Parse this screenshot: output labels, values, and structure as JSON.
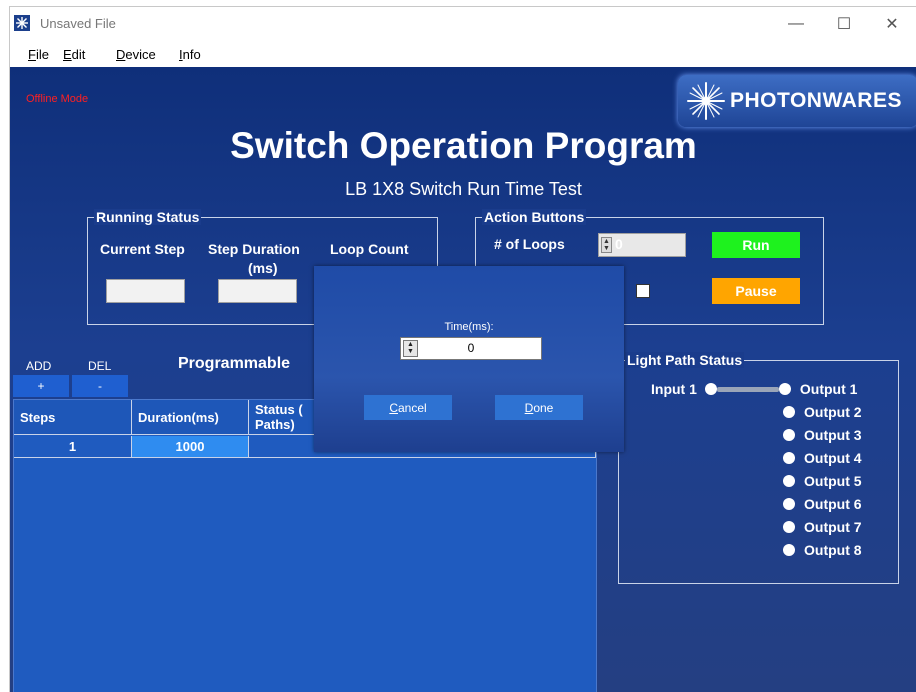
{
  "window": {
    "title": "Unsaved File",
    "controls": {
      "minimize": "—",
      "maximize": "☐",
      "close": "✕"
    }
  },
  "menu": {
    "items": [
      {
        "accel": "F",
        "rest": "ile"
      },
      {
        "accel": "E",
        "rest": "dit"
      },
      {
        "accel": "D",
        "rest": "evice"
      },
      {
        "accel": "I",
        "rest": "nfo"
      }
    ]
  },
  "header": {
    "offline_mode": "Offline Mode",
    "logo_text": "PHOTONWARES",
    "title": "Switch Operation Program",
    "subtitle": "LB 1X8 Switch Run Time Test"
  },
  "running_status": {
    "label": "Running Status",
    "current_step": "Current Step",
    "step_duration_1": "Step Duration",
    "step_duration_2": "(ms)",
    "loop_count": "Loop Count"
  },
  "action_buttons": {
    "label": "Action Buttons",
    "loops_label": "# of Loops",
    "loops_value": "0",
    "run": "Run",
    "pause": "Pause"
  },
  "programmable": {
    "add_label": "ADD",
    "del_label": "DEL",
    "add_button": "+",
    "del_button": "-",
    "title": "Programmable",
    "columns": [
      "Steps",
      "Duration(ms)",
      "Status (\nPaths)"
    ],
    "rows": [
      {
        "step": "1",
        "duration": "1000"
      }
    ]
  },
  "light_path": {
    "label": "Light Path Status",
    "input": "Input 1",
    "outputs": [
      "Output 1",
      "Output 2",
      "Output 3",
      "Output 4",
      "Output 5",
      "Output 6",
      "Output 7",
      "Output 8"
    ]
  },
  "dialog": {
    "label": "Time(ms):",
    "value": "0",
    "cancel": {
      "accel": "C",
      "rest": "ancel"
    },
    "done": {
      "accel": "D",
      "rest": "one"
    }
  },
  "colors": {
    "run_green": "#1ef21e",
    "pause_orange": "#ffa500",
    "offline_red": "#ff2020",
    "background_blue": "#1c3f90"
  }
}
